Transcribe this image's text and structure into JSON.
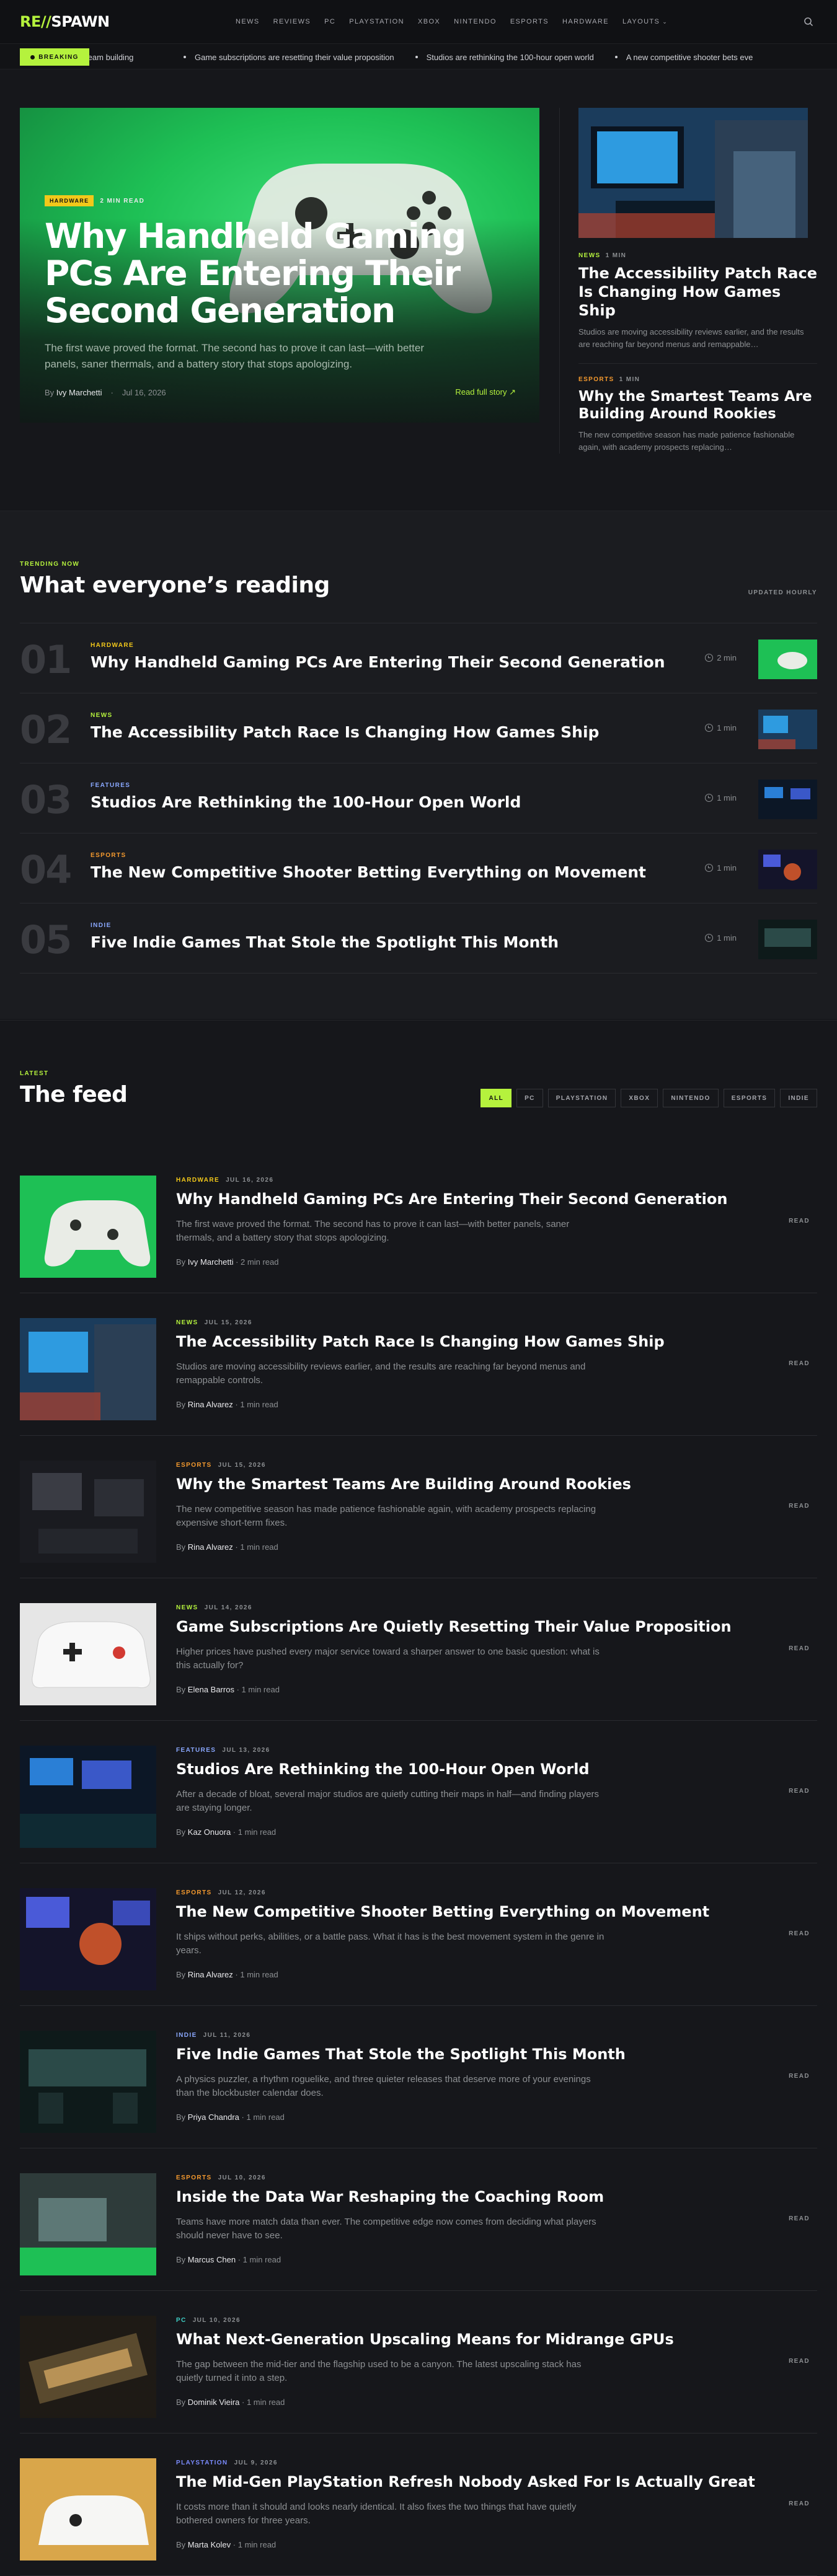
{
  "header": {
    "logo_a": "RE//",
    "logo_b": "SPAWN",
    "nav": [
      "NEWS",
      "REVIEWS",
      "PC",
      "PLAYSTATION",
      "XBOX",
      "NINTENDO",
      "ESPORTS",
      "HARDWARE",
      "LAYOUTS"
    ]
  },
  "ticker": {
    "label": "BREAKING",
    "first": "ng team building",
    "items": [
      "Game subscriptions are resetting their value proposition",
      "Studios are rethinking the 100-hour open world",
      "A new competitive shooter bets eve"
    ]
  },
  "hero": {
    "category": "HARDWARE",
    "readtime": "2 MIN READ",
    "title": "Why Handheld Gaming PCs Are Entering Their Second Generation",
    "dek": "The first wave proved the format. The second has to prove it can last—with better panels, saner thermals, and a battery story that stops apologizing.",
    "by": "By",
    "author": "Ivy Marchetti",
    "date": "Jul 16, 2026",
    "full": "Read full story ↗"
  },
  "side": [
    {
      "category": "NEWS",
      "mins": "1 MIN",
      "title": "The Accessibility Patch Race Is Changing How Games Ship",
      "dek": "Studios are moving accessibility reviews earlier, and the results are reaching far beyond menus and remappable…"
    },
    {
      "category": "ESPORTS",
      "mins": "1 MIN",
      "title": "Why the Smartest Teams Are Building Around Rookies",
      "dek": "The new competitive season has made patience fashionable again, with academy prospects replacing…"
    }
  ],
  "trending": {
    "kicker": "TRENDING NOW",
    "title": "What everyone’s reading",
    "updated": "UPDATED HOURLY",
    "rows": [
      {
        "num": "01",
        "category": "HARDWARE",
        "title": "Why Handheld Gaming PCs Are Entering Their Second Generation",
        "time": "2 min"
      },
      {
        "num": "02",
        "category": "NEWS",
        "title": "The Accessibility Patch Race Is Changing How Games Ship",
        "time": "1 min"
      },
      {
        "num": "03",
        "category": "FEATURES",
        "title": "Studios Are Rethinking the 100-Hour Open World",
        "time": "1 min"
      },
      {
        "num": "04",
        "category": "ESPORTS",
        "title": "The New Competitive Shooter Betting Everything on Movement",
        "time": "1 min"
      },
      {
        "num": "05",
        "category": "INDIE",
        "title": "Five Indie Games That Stole the Spotlight This Month",
        "time": "1 min"
      }
    ]
  },
  "feed": {
    "kicker": "LATEST",
    "title": "The feed",
    "filters": [
      "ALL",
      "PC",
      "PLAYSTATION",
      "XBOX",
      "NINTENDO",
      "ESPORTS",
      "INDIE"
    ],
    "read": "READ",
    "by": "By",
    "items": [
      {
        "category": "HARDWARE",
        "date": "JUL 16, 2026",
        "title": "Why Handheld Gaming PCs Are Entering Their Second Generation",
        "dek": "The first wave proved the format. The second has to prove it can last—with better panels, saner thermals, and a battery story that stops apologizing.",
        "author": "Ivy Marchetti",
        "mins": "· 2 min read"
      },
      {
        "category": "NEWS",
        "date": "JUL 15, 2026",
        "title": "The Accessibility Patch Race Is Changing How Games Ship",
        "dek": "Studios are moving accessibility reviews earlier, and the results are reaching far beyond menus and remappable controls.",
        "author": "Rina Alvarez",
        "mins": "· 1 min read"
      },
      {
        "category": "ESPORTS",
        "date": "JUL 15, 2026",
        "title": "Why the Smartest Teams Are Building Around Rookies",
        "dek": "The new competitive season has made patience fashionable again, with academy prospects replacing expensive short-term fixes.",
        "author": "Rina Alvarez",
        "mins": "· 1 min read"
      },
      {
        "category": "NEWS",
        "date": "JUL 14, 2026",
        "title": "Game Subscriptions Are Quietly Resetting Their Value Proposition",
        "dek": "Higher prices have pushed every major service toward a sharper answer to one basic question: what is this actually for?",
        "author": "Elena Barros",
        "mins": "· 1 min read"
      },
      {
        "category": "FEATURES",
        "date": "JUL 13, 2026",
        "title": "Studios Are Rethinking the 100-Hour Open World",
        "dek": "After a decade of bloat, several major studios are quietly cutting their maps in half—and finding players are staying longer.",
        "author": "Kaz Onuora",
        "mins": "· 1 min read"
      },
      {
        "category": "ESPORTS",
        "date": "JUL 12, 2026",
        "title": "The New Competitive Shooter Betting Everything on Movement",
        "dek": "It ships without perks, abilities, or a battle pass. What it has is the best movement system in the genre in years.",
        "author": "Rina Alvarez",
        "mins": "· 1 min read"
      },
      {
        "category": "INDIE",
        "date": "JUL 11, 2026",
        "title": "Five Indie Games That Stole the Spotlight This Month",
        "dek": "A physics puzzler, a rhythm roguelike, and three quieter releases that deserve more of your evenings than the blockbuster calendar does.",
        "author": "Priya Chandra",
        "mins": "· 1 min read"
      },
      {
        "category": "ESPORTS",
        "date": "JUL 10, 2026",
        "title": "Inside the Data War Reshaping the Coaching Room",
        "dek": "Teams have more match data than ever. The competitive edge now comes from deciding what players should never have to see.",
        "author": "Marcus Chen",
        "mins": "· 1 min read"
      },
      {
        "category": "PC",
        "date": "JUL 10, 2026",
        "title": "What Next-Generation Upscaling Means for Midrange GPUs",
        "dek": "The gap between the mid-tier and the flagship used to be a canyon. The latest upscaling stack has quietly turned it into a step.",
        "author": "Dominik Vieira",
        "mins": "· 1 min read"
      },
      {
        "category": "PLAYSTATION",
        "date": "JUL 9, 2026",
        "title": "The Mid-Gen PlayStation Refresh Nobody Asked For Is Actually Great",
        "dek": "It costs more than it should and looks nearly identical. It also fixes the two things that have quietly bothered owners for three years.",
        "author": "Marta Kolev",
        "mins": "· 1 min read"
      }
    ]
  },
  "colors": {
    "accent": "#b5f23d",
    "hardware": "#f2c81a",
    "news": "#b5f23d",
    "esports": "#f59a2e",
    "features": "#8aa8ff",
    "indie": "#8aa8ff",
    "pc": "#3fd1c8",
    "playstation": "#7b8cff"
  }
}
